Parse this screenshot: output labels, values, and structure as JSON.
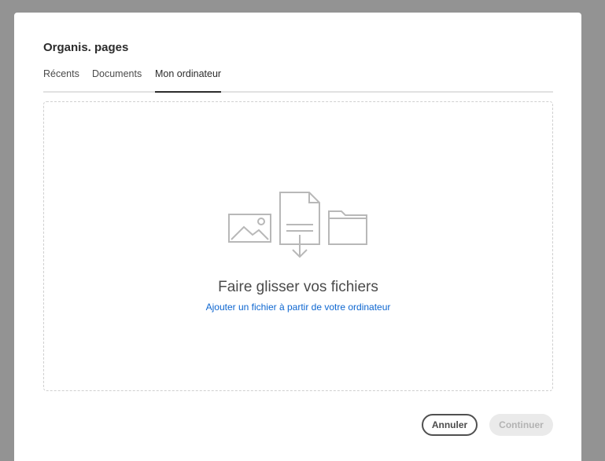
{
  "dialog": {
    "title": "Organis. pages"
  },
  "tabs": [
    {
      "label": "Récents",
      "active": false
    },
    {
      "label": "Documents",
      "active": false
    },
    {
      "label": "Mon ordinateur",
      "active": true
    }
  ],
  "dropzone": {
    "title": "Faire glisser vos fichiers",
    "link": "Ajouter un fichier à partir de votre ordinateur",
    "icons": [
      "image-icon",
      "document-download-icon",
      "folder-icon"
    ]
  },
  "buttons": {
    "cancel": "Annuler",
    "continue": "Continuer"
  },
  "colors": {
    "overlay": "#939393",
    "link": "#0d66d0",
    "icon": "#b8b8b8",
    "active_tab": "#2c2c2c"
  }
}
